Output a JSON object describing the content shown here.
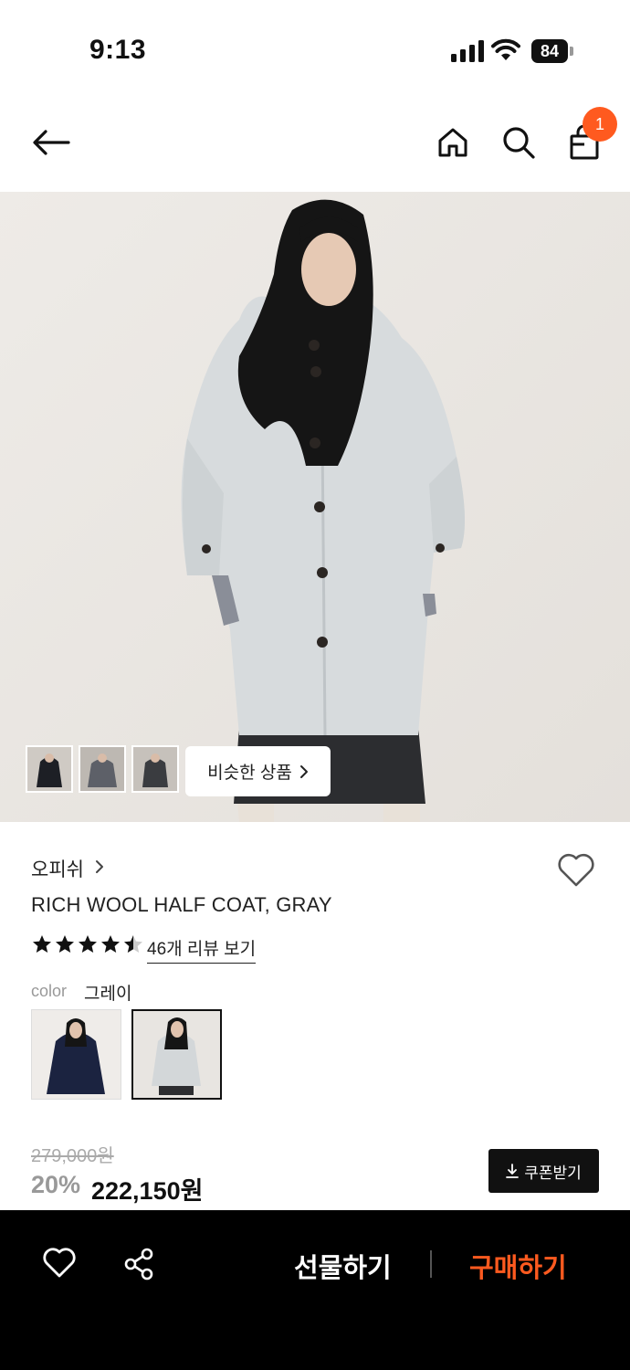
{
  "status_bar": {
    "time": "9:13",
    "battery": "84"
  },
  "nav": {
    "cart_count": "1"
  },
  "hero": {
    "similar_label": "비슷한 상품"
  },
  "product": {
    "brand": "오피쉬",
    "title": "RICH WOOL HALF COAT, GRAY",
    "rating": 4.5,
    "review_link": "46개 리뷰 보기",
    "color_label": "color",
    "color_value": "그레이",
    "original_price": "279,000원",
    "discount": "20%",
    "price": "222,150원",
    "coupon_label": "쿠폰받기"
  },
  "bottom_bar": {
    "gift_label": "선물하기",
    "buy_label": "구매하기"
  },
  "colors": {
    "accent": "#ff5a1f",
    "bottom_bar_bg": "#000000"
  },
  "icons": [
    "back-arrow-icon",
    "home-icon",
    "search-icon",
    "shopping-bag-icon",
    "chevron-right-icon",
    "heart-icon",
    "star-icon",
    "download-icon",
    "share-icon"
  ]
}
